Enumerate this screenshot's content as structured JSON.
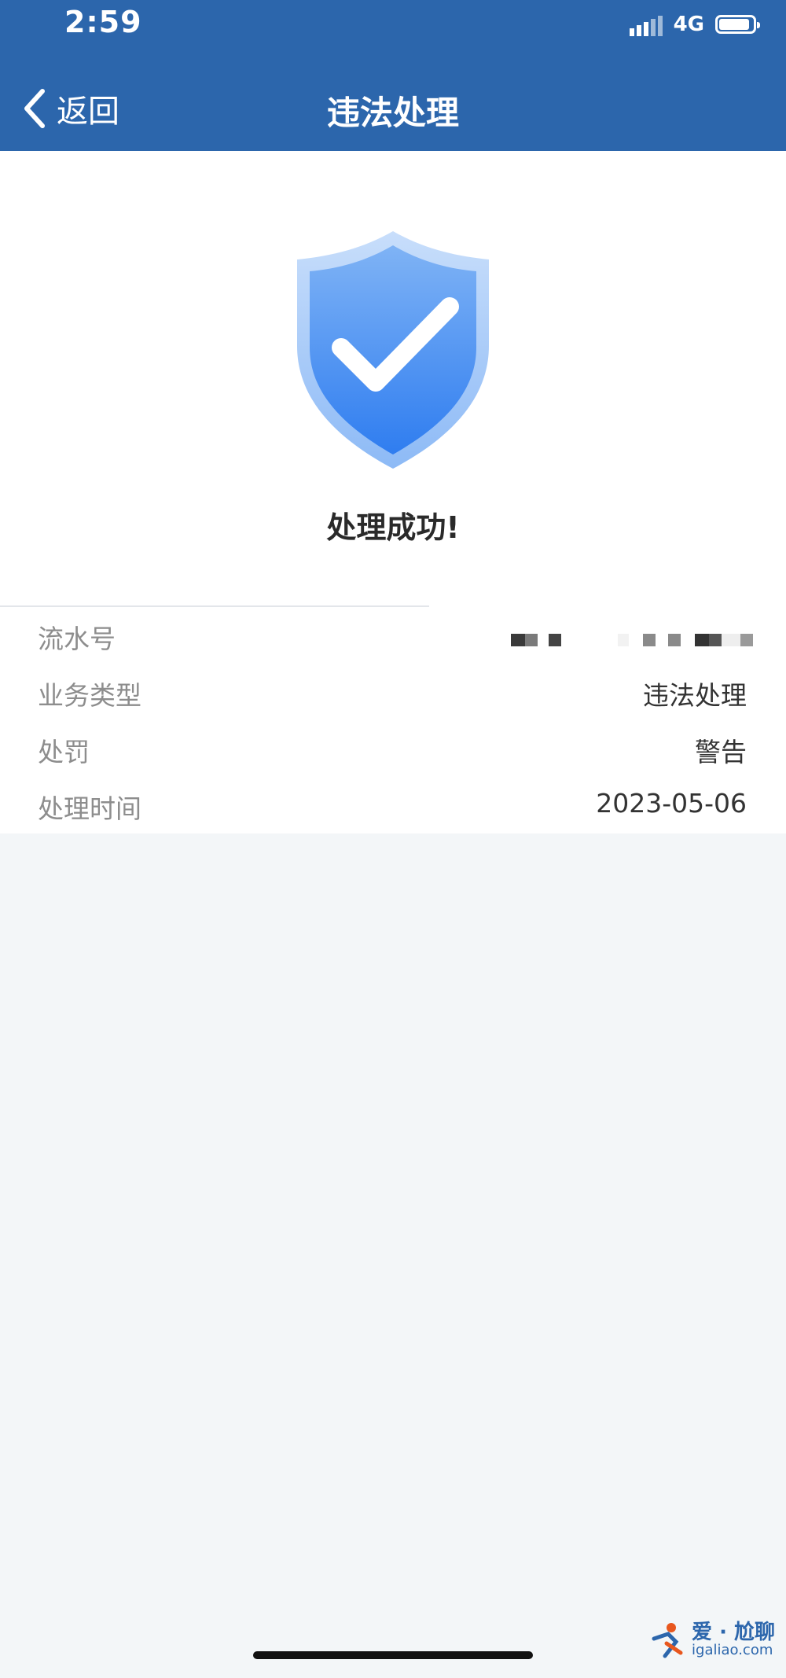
{
  "status_bar": {
    "time": "2:59",
    "network": "4G",
    "battery_level": 0.9
  },
  "header": {
    "back_label": "返回",
    "title": "违法处理",
    "background_color": "#2c66ac"
  },
  "result": {
    "icon": "shield-check-icon",
    "message": "处理成功!"
  },
  "details": [
    {
      "label": "流水号",
      "value": ""
    },
    {
      "label": "业务类型",
      "value": "违法处理"
    },
    {
      "label": "处罚",
      "value": "警告"
    },
    {
      "label": "处理时间",
      "value": "2023-05-06"
    }
  ],
  "watermark": {
    "title": "爱 · 尬聊",
    "url": "igaliao.com"
  }
}
